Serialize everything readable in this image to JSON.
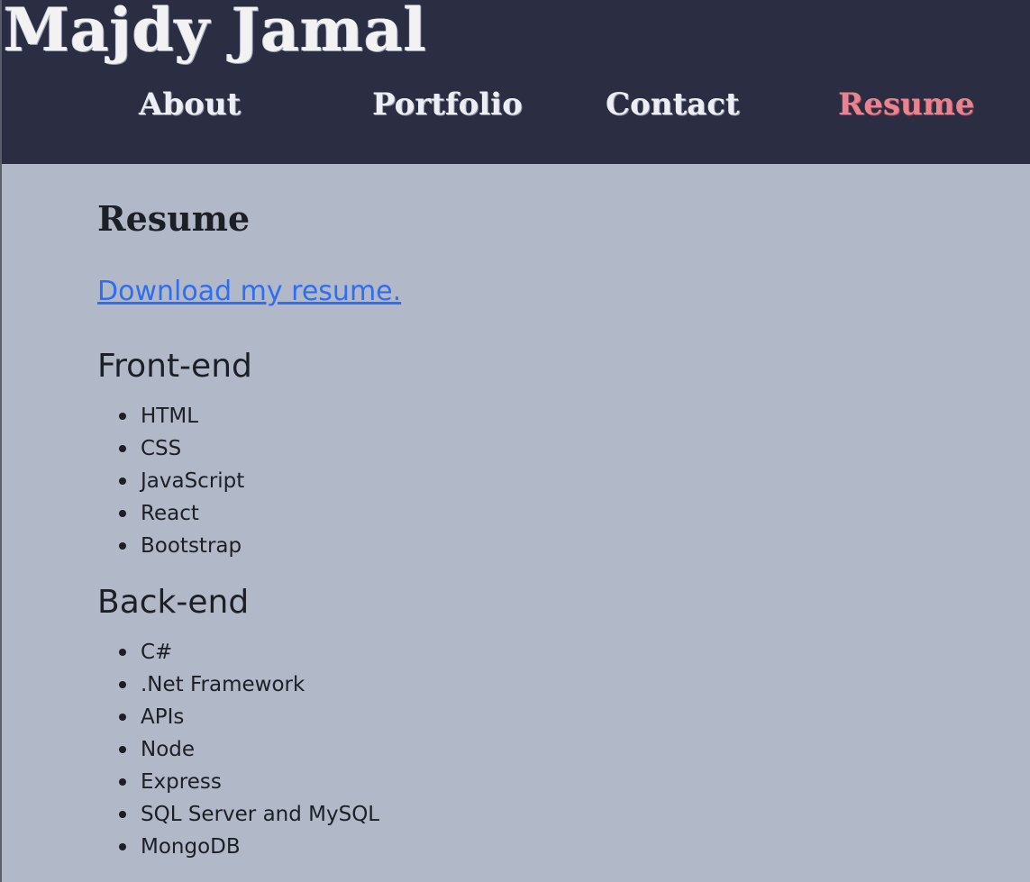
{
  "header": {
    "site_title": "Majdy Jamal",
    "nav": [
      {
        "label": "About",
        "active": false
      },
      {
        "label": "Portfolio",
        "active": false
      },
      {
        "label": "Contact",
        "active": false
      },
      {
        "label": "Resume",
        "active": true
      }
    ]
  },
  "main": {
    "heading": "Resume",
    "download_link": "Download my resume.",
    "frontend": {
      "heading": "Front-end",
      "items": [
        "HTML",
        "CSS",
        "JavaScript",
        "React",
        "Bootstrap"
      ]
    },
    "backend": {
      "heading": "Back-end",
      "items": [
        "C#",
        ".Net Framework",
        "APIs",
        "Node",
        "Express",
        "SQL Server and MySQL",
        "MongoDB"
      ]
    }
  },
  "colors": {
    "header_bg": "#2b2d42",
    "page_bg": "#b1b8c8",
    "active_nav": "#e8838f",
    "link": "#2f6ef0"
  }
}
